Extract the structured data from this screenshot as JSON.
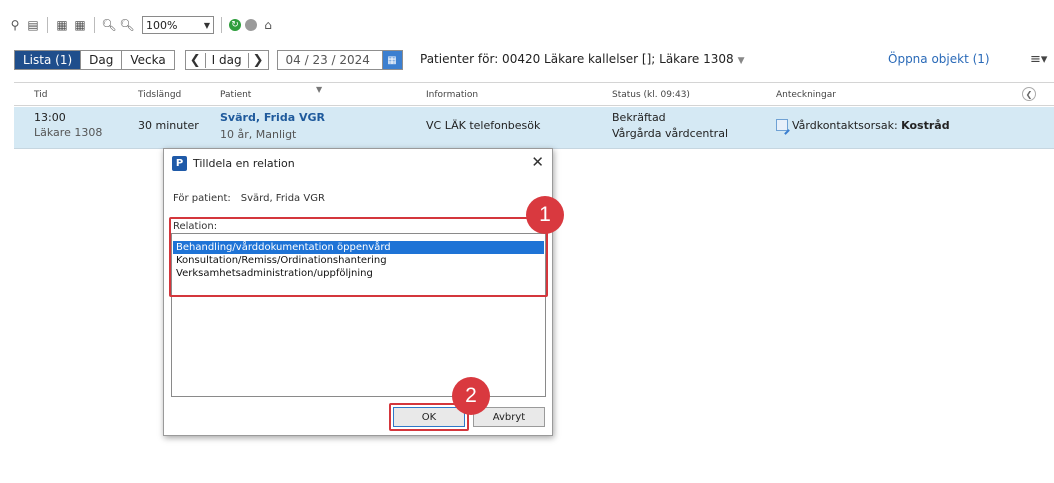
{
  "toolbar": {
    "zoom_value": "100%"
  },
  "nav": {
    "view_tabs": [
      {
        "label": "Lista (1)",
        "active": true
      },
      {
        "label": "Dag",
        "active": false
      },
      {
        "label": "Vecka",
        "active": false
      }
    ],
    "today_label": "I dag",
    "date_value": "04 / 23 / 2024",
    "patients_for": "Patienter för: 00420 Läkare kallelser []; Läkare 1308",
    "open_objects": "Öppna objekt (1)"
  },
  "table": {
    "headers": [
      "Tid",
      "Tidslängd",
      "Patient",
      "Information",
      "Status (kl. 09:43)",
      "Anteckningar"
    ],
    "row": {
      "time": "13:00",
      "doctor": "Läkare 1308",
      "duration": "30 minuter",
      "patient_name": "Svärd, Frida VGR",
      "patient_sub": "10 år, Manligt",
      "information": "VC LÄK telefonbesök",
      "status": "Bekräftad",
      "status_place": "Vårgårda vårdcentral",
      "note_label": "Vårdkontaktsorsak:",
      "note_value": "Kostråd"
    }
  },
  "dialog": {
    "title": "Tilldela en relation",
    "for_patient_label": "För patient:",
    "for_patient_value": "Svärd, Frida VGR",
    "relation_label": "Relation:",
    "relations": [
      "Behandling/vårddokumentation öppenvård",
      "Konsultation/Remiss/Ordinationshantering",
      "Verksamhetsadministration/uppföljning"
    ],
    "selected_index": 0,
    "ok_label": "OK",
    "cancel_label": "Avbryt"
  },
  "annotations": {
    "badge1": "1",
    "badge2": "2",
    "color": "#d9393f"
  }
}
